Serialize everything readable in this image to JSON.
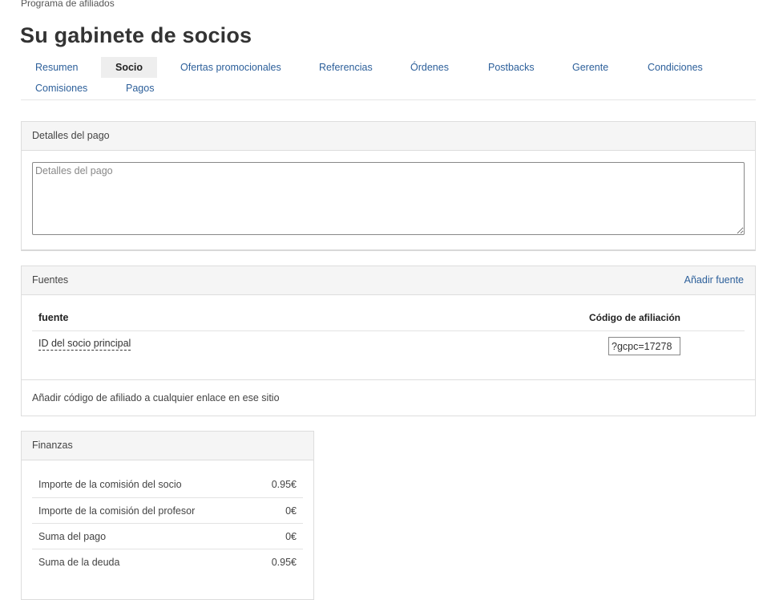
{
  "breadcrumb": "Programa de afiliados",
  "title": "Su gabinete de socios",
  "tabs": [
    {
      "label": "Resumen",
      "active": false
    },
    {
      "label": "Socio",
      "active": true
    },
    {
      "label": "Ofertas promocionales",
      "active": false
    },
    {
      "label": "Referencias",
      "active": false
    },
    {
      "label": "Órdenes",
      "active": false
    },
    {
      "label": "Postbacks",
      "active": false
    },
    {
      "label": "Gerente",
      "active": false
    },
    {
      "label": "Condiciones",
      "active": false
    },
    {
      "label": "Comisiones",
      "active": false
    },
    {
      "label": "Pagos",
      "active": false
    }
  ],
  "pago": {
    "heading": "Detalles del pago",
    "textarea_placeholder": "Detalles del pago",
    "textarea_value": ""
  },
  "fuentes": {
    "heading": "Fuentes",
    "add_link": "Añadir fuente",
    "columns": {
      "fuente": "fuente",
      "codigo": "Código de afiliación"
    },
    "rows": [
      {
        "fuente": "ID del socio principal",
        "codigo": "?gcpc=17278"
      }
    ],
    "footer": "Añadir código de afiliado a cualquier enlace en ese sitio"
  },
  "finanzas": {
    "heading": "Finanzas",
    "rows": [
      {
        "label": "Importe de la comisión del socio",
        "value": "0.95€"
      },
      {
        "label": "Importe de la comisión del profesor",
        "value": "0€"
      },
      {
        "label": "Suma del pago",
        "value": "0€"
      },
      {
        "label": "Suma de la deuda",
        "value": "0.95€"
      }
    ]
  },
  "colors": {
    "link": "#2c5f9a",
    "panel_heading_bg": "#f5f5f5",
    "active_tab_bg": "#eeeeee"
  }
}
